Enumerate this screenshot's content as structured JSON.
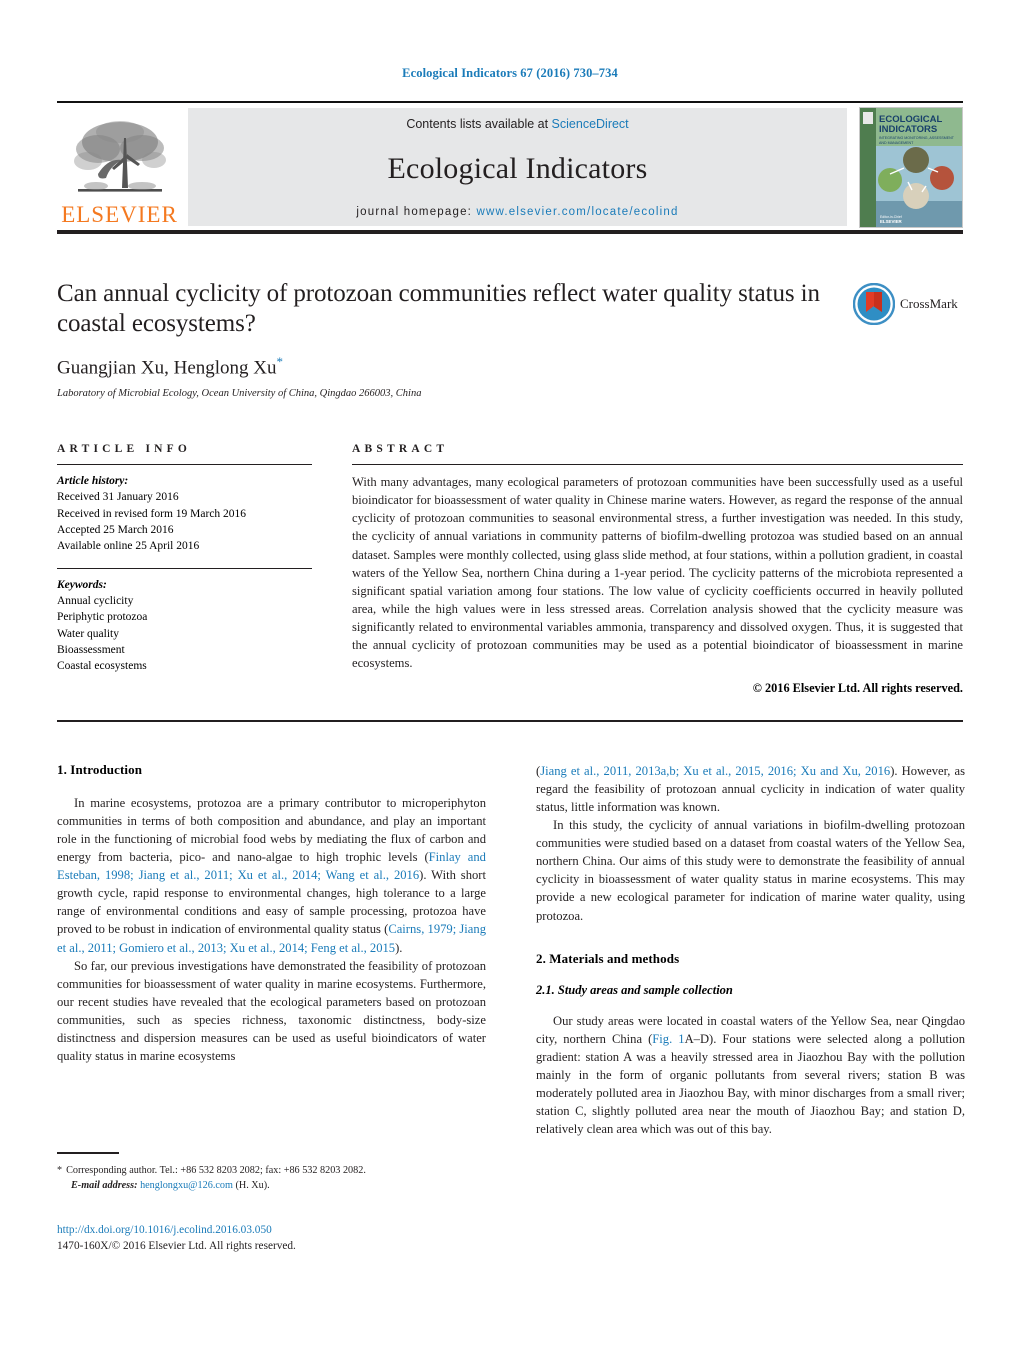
{
  "running_head": "Ecological Indicators 67 (2016) 730–734",
  "masthead": {
    "contents_prefix": "Contents lists available at ",
    "sciencedirect": "ScienceDirect",
    "journal_title": "Ecological Indicators",
    "homepage_prefix": "journal homepage: ",
    "homepage_url": "www.elsevier.com/locate/ecolind",
    "publisher": "ELSEVIER",
    "cover_title_line1": "ECOLOGICAL",
    "cover_title_line2": "INDICATORS",
    "cover_subtitle": "INTEGRATING MONITORING, ASSESSMENT AND MANAGEMENT",
    "link_color": "#1a7bb9",
    "publisher_color": "#f47920",
    "band_color": "#e6e7e8"
  },
  "article": {
    "title": "Can annual cyclicity of protozoan communities reflect water quality status in coastal ecosystems?",
    "authors": "Guangjian Xu, Henglong Xu",
    "author_marker": "*",
    "affiliation": "Laboratory of Microbial Ecology, Ocean University of China, Qingdao 266003, China",
    "crossmark_label": "CrossMark"
  },
  "article_info": {
    "heading": "ARTICLE INFO",
    "history_label": "Article history:",
    "history": [
      "Received 31 January 2016",
      "Received in revised form 19 March 2016",
      "Accepted 25 March 2016",
      "Available online 25 April 2016"
    ],
    "keywords_label": "Keywords:",
    "keywords": [
      "Annual cyclicity",
      "Periphytic protozoa",
      "Water quality",
      "Bioassessment",
      "Coastal ecosystems"
    ]
  },
  "abstract": {
    "heading": "ABSTRACT",
    "text": "With many advantages, many ecological parameters of protozoan communities have been successfully used as a useful bioindicator for bioassessment of water quality in Chinese marine waters. However, as regard the response of the annual cyclicity of protozoan communities to seasonal environmental stress, a further investigation was needed. In this study, the cyclicity of annual variations in community patterns of biofilm-dwelling protozoa was studied based on an annual dataset. Samples were monthly collected, using glass slide method, at four stations, within a pollution gradient, in coastal waters of the Yellow Sea, northern China during a 1-year period. The cyclicity patterns of the microbiota represented a significant spatial variation among four stations. The low value of cyclicity coefficients occurred in heavily polluted area, while the high values were in less stressed areas. Correlation analysis showed that the cyclicity measure was significantly related to environmental variables ammonia, transparency and dissolved oxygen. Thus, it is suggested that the annual cyclicity of protozoan communities may be used as a potential bioindicator of bioassessment in marine ecosystems.",
    "copyright": "© 2016 Elsevier Ltd. All rights reserved."
  },
  "body": {
    "left": {
      "intro_heading": "1.  Introduction",
      "para1_a": "In marine ecosystems, protozoa are a primary contributor to microperiphyton communities in terms of both composition and abundance, and play an important role in the functioning of microbial food webs by mediating the flux of carbon and energy from bacteria, pico- and nano-algae to high trophic levels (",
      "para1_cite": "Finlay and Esteban, 1998; Jiang et al., 2011; Xu et al., 2014; Wang et al., 2016",
      "para1_b": "). With short growth cycle, rapid response to environmental changes, high tolerance to a large range of environmental conditions and easy of sample processing, protozoa have proved to be robust in indication of environmental quality status (",
      "para1_cite2": "Cairns, 1979; Jiang et al., 2011; Gomiero et al., 2013; Xu et al., 2014; Feng et al., 2015",
      "para1_c": ").",
      "para2": "So far, our previous investigations have demonstrated the feasibility of protozoan communities for bioassessment of water quality in marine ecosystems. Furthermore, our recent studies have revealed that the ecological parameters based on protozoan communities, such as species richness, taxonomic distinctness, body-size distinctness and dispersion measures can be used as useful bioindicators of water quality status in marine ecosystems"
    },
    "right": {
      "para1_cite": "Jiang et al., 2011, 2013a,b; Xu et al., 2015, 2016; Xu and Xu, 2016",
      "para1_a": "(",
      "para1_b": "). However, as regard the feasibility of protozoan annual cyclicity in indication of water quality status, little information was known.",
      "para2": "In this study, the cyclicity of annual variations in biofilm-dwelling protozoan communities were studied based on a dataset from coastal waters of the Yellow Sea, northern China. Our aims of this study were to demonstrate the feasibility of annual cyclicity in bioassessment of water quality status in marine ecosystems. This may provide a new ecological parameter for indication of marine water quality, using protozoa.",
      "methods_heading": "2.  Materials and methods",
      "sub_heading": "2.1.  Study areas and sample collection",
      "para3_a": "Our study areas were located in coastal waters of the Yellow Sea, near Qingdao city, northern China (",
      "para3_cite": "Fig. 1",
      "para3_b": "A–D). Four stations were selected along a pollution gradient: station A was a heavily stressed area in Jiaozhou Bay with the pollution mainly in the form of organic pollutants from several rivers; station B was moderately polluted area in Jiaozhou Bay, with minor discharges from a small river; station C, slightly polluted area near the mouth of Jiaozhou Bay; and station D, relatively clean area which was out of this bay."
    }
  },
  "footnotes": {
    "star": "*",
    "corresponding": "Corresponding author. Tel.: +86 532 8203 2082; fax: +86 532 8203 2082.",
    "email_label": "E-mail address:",
    "email": "henglongxu@126.com",
    "email_suffix": "(H. Xu).",
    "doi": "http://dx.doi.org/10.1016/j.ecolind.2016.03.050",
    "issn": "1470-160X/© 2016 Elsevier Ltd. All rights reserved."
  }
}
